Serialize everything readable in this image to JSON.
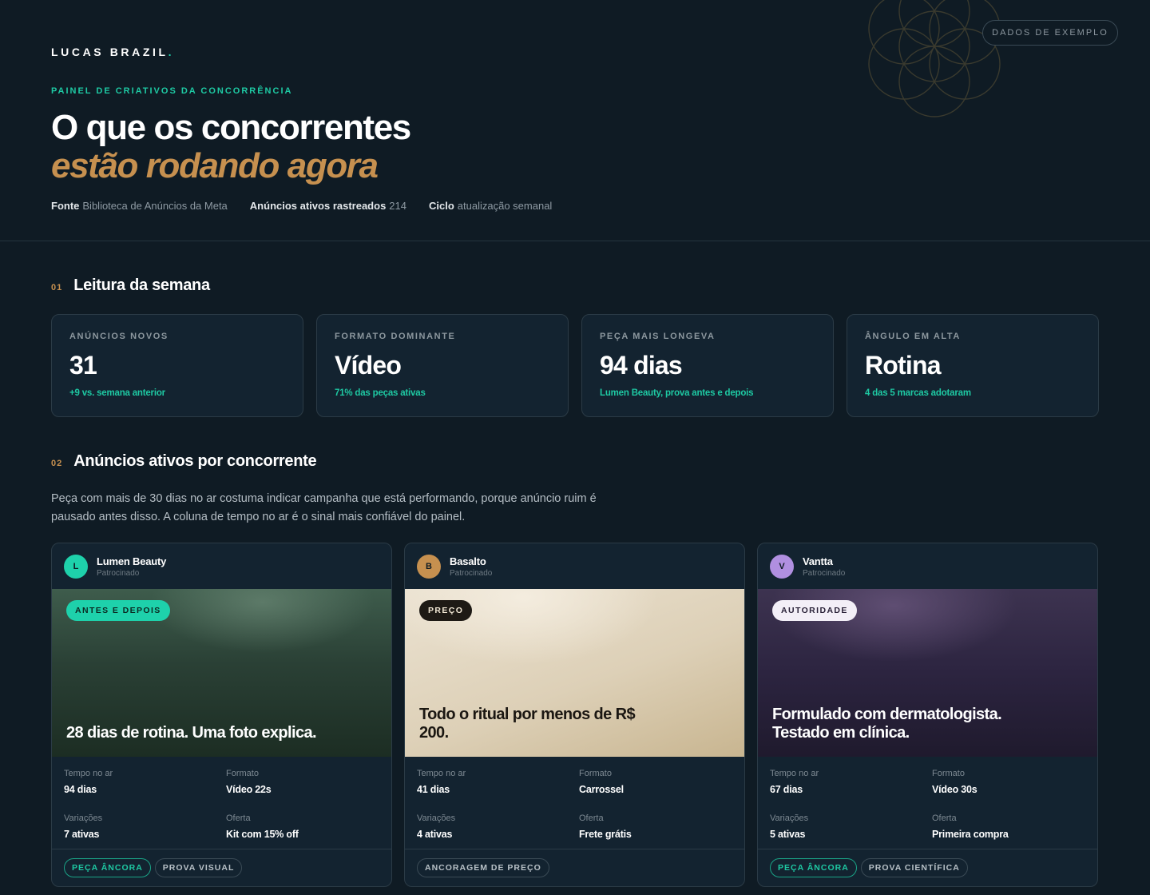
{
  "header": {
    "brand": "LUCAS BRAZIL",
    "brand_dot": ".",
    "sample_badge": "DADOS DE EXEMPLO",
    "eyebrow": "PAINEL DE CRIATIVOS DA CONCORRÊNCIA",
    "title_line1": "O que os concorrentes",
    "title_line2": "estão rodando agora",
    "meta": [
      {
        "label": "Fonte",
        "value": "Biblioteca de Anúncios da Meta"
      },
      {
        "label": "Anúncios ativos rastreados",
        "value": "214"
      },
      {
        "label": "Ciclo",
        "value": "atualização semanal"
      }
    ]
  },
  "section1": {
    "number": "01",
    "title": "Leitura da semana",
    "stats": [
      {
        "label": "ANÚNCIOS NOVOS",
        "value": "31",
        "sub": "+9 vs. semana anterior"
      },
      {
        "label": "FORMATO DOMINANTE",
        "value": "Vídeo",
        "sub": "71% das peças ativas"
      },
      {
        "label": "PEÇA MAIS LONGEVA",
        "value": "94 dias",
        "sub": "Lumen Beauty, prova antes e depois"
      },
      {
        "label": "ÂNGULO EM ALTA",
        "value": "Rotina",
        "sub": "4 das 5 marcas adotaram"
      }
    ]
  },
  "section2": {
    "number": "02",
    "title": "Anúncios ativos por concorrente",
    "lede": "Peça com mais de 30 dias no ar costuma indicar campanha que está performando, porque anúncio ruim é pausado antes disso. A coluna de tempo no ar é o sinal mais confiável do painel.",
    "cards": [
      {
        "initial": "L",
        "brand": "Lumen Beauty",
        "sponsored": "Patrocinado",
        "avatar_color": "#1ed1ab",
        "angle": "ANTES E DEPOIS",
        "headline": "28 dias de rotina. Uma foto explica.",
        "specs": [
          {
            "label": "Tempo no ar",
            "value": "94 dias"
          },
          {
            "label": "Formato",
            "value": "Vídeo 22s"
          },
          {
            "label": "Variações",
            "value": "7 ativas"
          },
          {
            "label": "Oferta",
            "value": "Kit com 15% off"
          }
        ],
        "chips": [
          "PEÇA ÂNCORA",
          "PROVA VISUAL"
        ]
      },
      {
        "initial": "B",
        "brand": "Basalto",
        "sponsored": "Patrocinado",
        "avatar_color": "#c6904f",
        "angle": "PREÇO",
        "headline": "Todo o ritual por menos de R$ 200.",
        "specs": [
          {
            "label": "Tempo no ar",
            "value": "41 dias"
          },
          {
            "label": "Formato",
            "value": "Carrossel"
          },
          {
            "label": "Variações",
            "value": "4 ativas"
          },
          {
            "label": "Oferta",
            "value": "Frete grátis"
          }
        ],
        "chips": [
          "ANCORAGEM DE PREÇO"
        ]
      },
      {
        "initial": "V",
        "brand": "Vantta",
        "sponsored": "Patrocinado",
        "avatar_color": "#b08fe0",
        "angle": "AUTORIDADE",
        "headline": "Formulado com dermatologista. Testado em clínica.",
        "specs": [
          {
            "label": "Tempo no ar",
            "value": "67 dias"
          },
          {
            "label": "Formato",
            "value": "Vídeo 30s"
          },
          {
            "label": "Variações",
            "value": "5 ativas"
          },
          {
            "label": "Oferta",
            "value": "Primeira compra"
          }
        ],
        "chips": [
          "PEÇA ÂNCORA",
          "PROVA CIENTÍFICA"
        ]
      }
    ]
  }
}
